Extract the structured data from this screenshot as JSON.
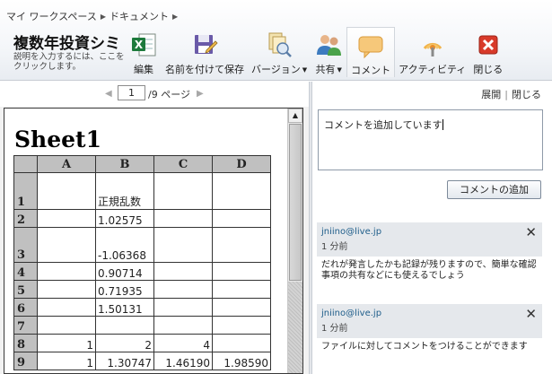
{
  "breadcrumb": {
    "workspace": "マイ ワークスペース",
    "folder": "ドキュメント"
  },
  "document": {
    "title": "複数年投資シミ",
    "description": "説明を入力するには、ここをクリックします。"
  },
  "toolbar": {
    "edit": {
      "label": "編集",
      "icon": "excel-icon"
    },
    "save_as": {
      "label": "名前を付けて保存",
      "icon": "save-as-icon"
    },
    "version": {
      "label": "バージョン",
      "icon": "version-icon"
    },
    "share": {
      "label": "共有",
      "icon": "share-icon"
    },
    "comments": {
      "label": "コメント",
      "icon": "comment-icon",
      "active": true
    },
    "activity": {
      "label": "アクティビティ",
      "icon": "activity-icon"
    },
    "close": {
      "label": "閉じる",
      "icon": "close-icon"
    }
  },
  "pager": {
    "current": "1",
    "total": "/9 ページ"
  },
  "sheet": {
    "name": "Sheet1",
    "columns": [
      "A",
      "B",
      "C",
      "D"
    ],
    "rows": [
      {
        "num": "1",
        "cells": [
          "",
          "正規乱数",
          "",
          ""
        ]
      },
      {
        "num": "2",
        "cells": [
          "",
          "1.02575",
          "",
          ""
        ]
      },
      {
        "num": "3",
        "cells": [
          "",
          "-1.06368",
          "",
          ""
        ]
      },
      {
        "num": "4",
        "cells": [
          "",
          "0.90714",
          "",
          ""
        ]
      },
      {
        "num": "5",
        "cells": [
          "",
          "0.71935",
          "",
          ""
        ]
      },
      {
        "num": "6",
        "cells": [
          "",
          "1.50131",
          "",
          ""
        ]
      },
      {
        "num": "7",
        "cells": [
          "",
          "",
          "",
          ""
        ]
      },
      {
        "num": "8",
        "cells": [
          "1",
          "2",
          "4",
          ""
        ]
      },
      {
        "num": "9",
        "cells": [
          "1",
          "1.30747",
          "1.46190",
          "1.98590"
        ]
      }
    ]
  },
  "comments_pane": {
    "expand": "展開",
    "collapse": "閉じる",
    "input_value": "コメントを追加しています",
    "add_button": "コメントの追加",
    "comments": [
      {
        "user": "jniino@live.jp",
        "time": "1 分前",
        "text": "だれが発言したかも記録が残りますので、簡単な確認事項の共有などにも使えるでしょう"
      },
      {
        "user": "jniino@live.jp",
        "time": "1 分前",
        "text": "ファイルに対してコメントをつけることができます"
      }
    ]
  },
  "colors": {
    "header_bg": "#f4f6f9",
    "card_bg": "#e5e8ec",
    "link": "#1e5d8a",
    "excel_green": "#1d7a3c",
    "close_red": "#d83a2a"
  }
}
